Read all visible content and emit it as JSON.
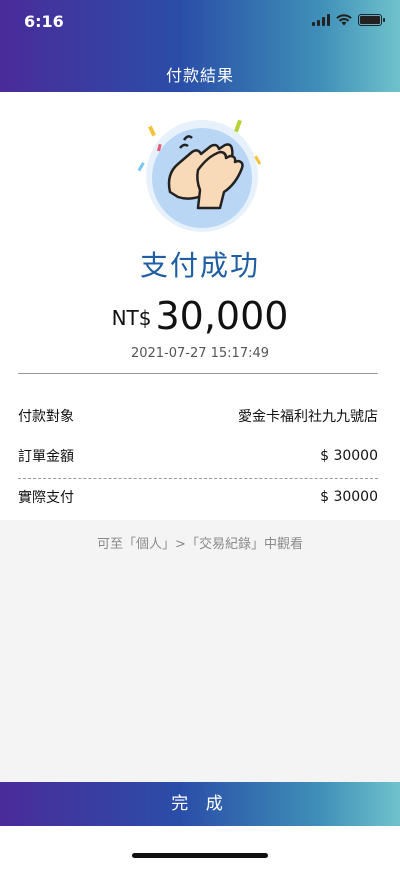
{
  "status_bar": {
    "time": "6:16",
    "icons": [
      "signal-icon",
      "wifi-icon",
      "battery-icon"
    ]
  },
  "header": {
    "title": "付款結果"
  },
  "result": {
    "illustration": "clapping-hands-icon",
    "status_text": "支付成功",
    "currency": "NT$",
    "amount": "30,000",
    "datetime": "2021-07-27 15:17:49"
  },
  "details": [
    {
      "label": "付款對象",
      "value": "愛金卡福利社九九號店"
    },
    {
      "label": "訂單金額",
      "value": "$ 30000"
    },
    {
      "label": "實際支付",
      "value": "$ 30000"
    }
  ],
  "hint": "可至「個人」>「交易紀錄」中觀看",
  "footer": {
    "done_label": "完 成"
  },
  "colors": {
    "accent": "#1f5ea3",
    "gradient_start": "#4a2b9a",
    "gradient_end": "#6fc2cc"
  }
}
